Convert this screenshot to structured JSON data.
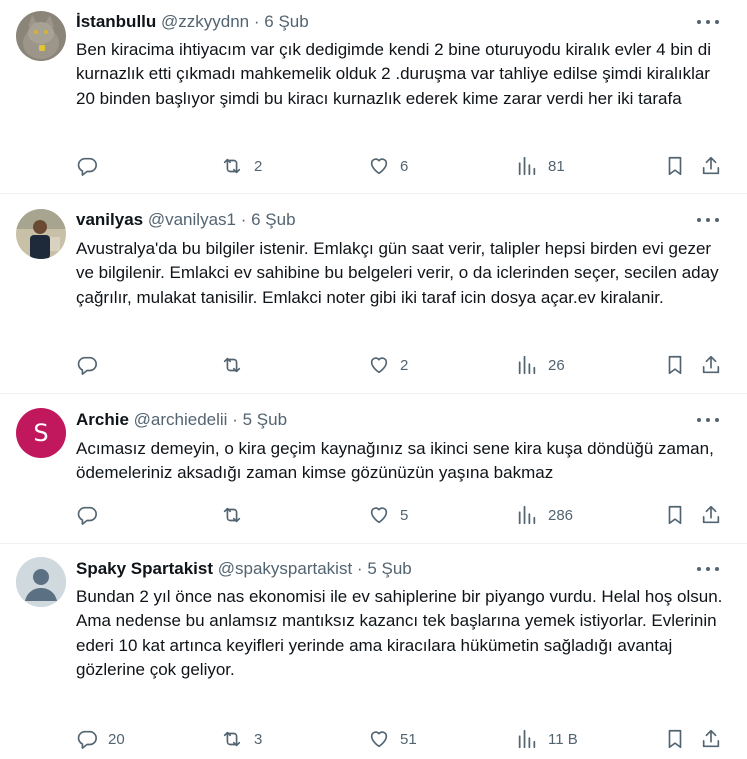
{
  "tweets": [
    {
      "name": "İstanbullu",
      "handle": "@zzkyydnn",
      "separator": "·",
      "date": "6 Şub",
      "text": "Ben kiracima ihtiyacım var çık dedigimde kendi 2 bine oturuyodu kiralık evler 4 bin di kurnazlık etti çıkmadı mahkemelik olduk 2 .duruşma var tahliye edilse şimdi kiralıklar 20 binden başlıyor şimdi bu kiracı kurnazlık ederek kime zarar verdi her iki tarafa",
      "replies": "",
      "retweets": "2",
      "likes": "6",
      "views": "81",
      "avatar": "cat-photo"
    },
    {
      "name": "vanilyas",
      "handle": "@vanilyas1",
      "separator": "·",
      "date": "6 Şub",
      "text": "Avustralya'da bu bilgiler istenir. Emlakçı gün saat verir, talipler hepsi birden evi gezer ve bilgilenir. Emlakci ev sahibine bu belgeleri verir, o da iclerinden seçer, secilen aday çağrılır, mulakat tanisilir. Emlakci noter gibi iki taraf icin dosya açar.ev kiralanir.",
      "replies": "",
      "retweets": "",
      "likes": "2",
      "views": "26",
      "avatar": "person-photo"
    },
    {
      "name": "Archie",
      "handle": "@archiedelii",
      "separator": "·",
      "date": "5 Şub",
      "text": "Acımasız demeyin, o kira geçim kaynağınız sa ikinci sene kira kuşa döndüğü zaman, ödemeleriniz aksadığı zaman kimse gözünüzün yaşına bakmaz",
      "replies": "",
      "retweets": "",
      "likes": "5",
      "views": "286",
      "avatar_letter": "S",
      "avatar_color": "#c0175d"
    },
    {
      "name": "Spaky Spartakist",
      "handle": "@spakyspartakist",
      "separator": "·",
      "date": "5 Şub",
      "text": "Bundan 2 yıl önce nas ekonomisi ile ev sahiplerine bir piyango vurdu. Helal hoş olsun.\nAma nedense bu anlamsız mantıksız kazancı tek başlarına yemek istiyorlar. Evlerinin ederi 10 kat artınca keyifleri yerinde ama kiracılara hükümetin sağladığı avantaj gözlerine çok geliyor.",
      "replies": "20",
      "retweets": "3",
      "likes": "51",
      "views": "11 B",
      "avatar": "default-profile"
    }
  ],
  "colors": {
    "text_primary": "#0f1419",
    "text_secondary": "#536471",
    "divider": "#eff3f4",
    "archie_avatar": "#c0175d"
  },
  "icons": [
    "more-icon",
    "reply-icon",
    "retweet-icon",
    "like-icon",
    "views-icon",
    "bookmark-icon",
    "share-icon"
  ]
}
